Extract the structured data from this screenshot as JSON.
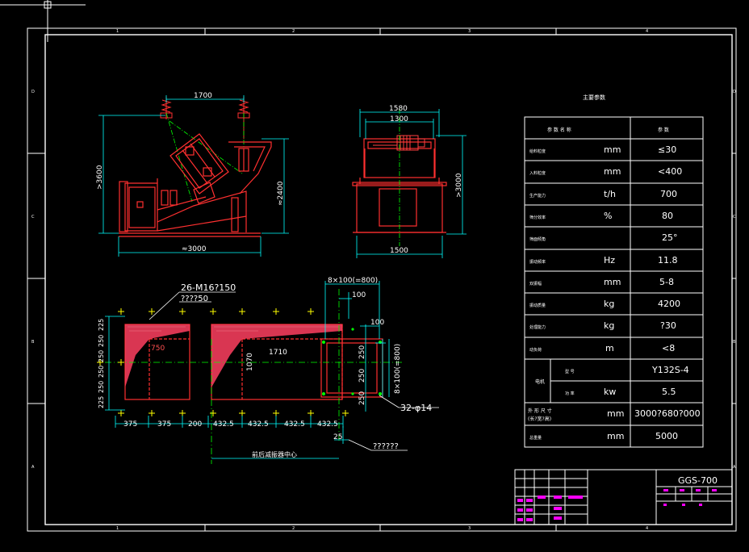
{
  "colors": {
    "background": "#000000",
    "frame": "#ffffff",
    "part": "#ff2020",
    "dimension": "#00ffff",
    "centerline": "#00ff00",
    "mark": "#ffff00",
    "hatch": "#ff4060",
    "motor": "#ff4040",
    "title_block": "#ff00ff"
  },
  "zone_marks": {
    "top": [
      "1",
      "2",
      "3",
      "4"
    ],
    "bottom": [
      "1",
      "2",
      "3",
      "4"
    ],
    "left": [
      "D",
      "C",
      "B",
      "A"
    ],
    "right": [
      "D",
      "C",
      "B",
      "A"
    ]
  },
  "side_view": {
    "dim_top": "1700",
    "dim_height": ">3600",
    "dim_right": "≈2400",
    "dim_bottom": "≈3000"
  },
  "end_view": {
    "dim_top_outer": "1580",
    "dim_top_inner": "1300",
    "dim_height": ">3000",
    "dim_bottom": "1500"
  },
  "foundation": {
    "callout_bolts": "26-M16?150",
    "callout_bolts_sub": "????50",
    "dim_top_span": "8×100(=800)",
    "dim_100_a": "100",
    "dim_100_b": "100",
    "dim_750": "750",
    "dim_1710": "1710",
    "dim_1070": "1070",
    "left_stack": [
      "225",
      "250",
      "250",
      "250",
      "250",
      "225"
    ],
    "right_stack": [
      "250",
      "250",
      "250"
    ],
    "right_span": "8×100(=800)",
    "holes": "32-φ14",
    "bottom_dims": [
      "375",
      "375",
      "200",
      "432.5",
      "432.5",
      "432.5",
      "432.5"
    ],
    "dim_25": "25",
    "center_note": "前后减振器中心",
    "callout_right": "??????"
  },
  "spec_table": {
    "title": "主要参数",
    "header": [
      "参 数 名 称",
      "参 数"
    ],
    "rows": [
      {
        "name": "给料粒度",
        "unit": "mm",
        "value": "≤30"
      },
      {
        "name": "入料粒度",
        "unit": "mm",
        "value": "<400"
      },
      {
        "name": "生产能力",
        "unit": "t/h",
        "value": "700"
      },
      {
        "name": "筛分效率",
        "unit": "%",
        "value": "80"
      },
      {
        "name": "筛面倾角",
        "unit": "",
        "value": "25°"
      },
      {
        "name": "振动频率",
        "unit": "Hz",
        "value": "11.8"
      },
      {
        "name": "双振幅",
        "unit": "mm",
        "value": "5-8"
      },
      {
        "name": "振动质量",
        "unit": "kg",
        "value": "4200"
      },
      {
        "name": "处理能力",
        "unit": "kg",
        "value": "?30"
      },
      {
        "name": "动负荷",
        "unit": "m",
        "value": "<8"
      }
    ],
    "motor_label": "电机",
    "motor_rows": [
      {
        "name": "型 号",
        "unit": "",
        "value": "Y132S-4"
      },
      {
        "name": "功 率",
        "unit": "kw",
        "value": "5.5"
      }
    ],
    "size_row": {
      "name": "外 形 尺 寸",
      "name2": "(长?宽?高)",
      "unit": "mm",
      "value": "3000?680?000"
    },
    "weight_row": {
      "name": "总重量",
      "unit": "mm",
      "value": "5000"
    }
  },
  "title_block": {
    "drawing_no": "GGS-700"
  }
}
